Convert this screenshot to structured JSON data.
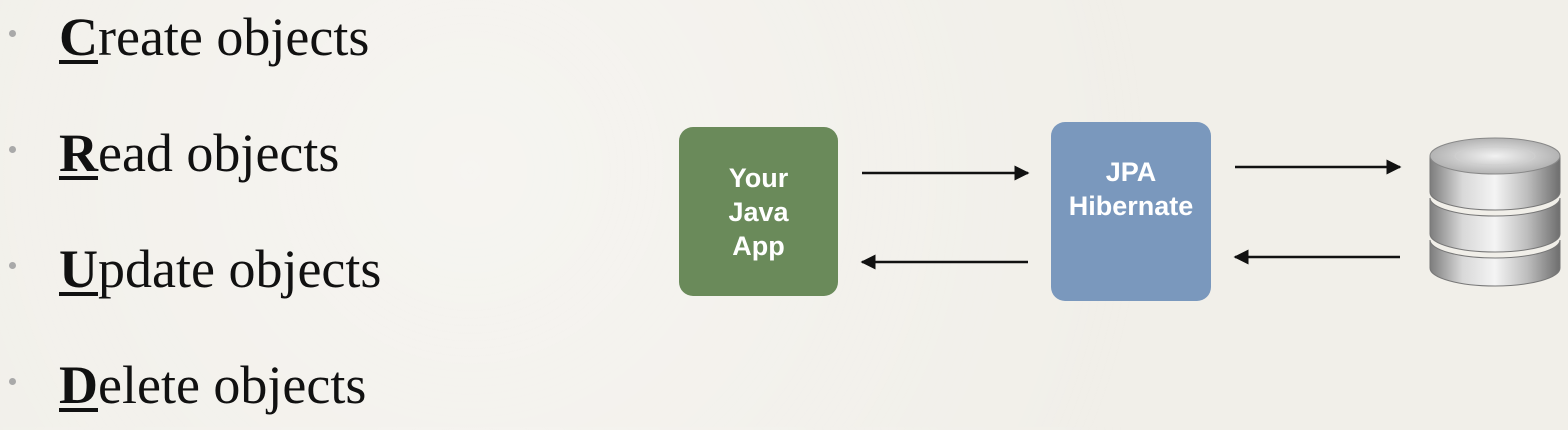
{
  "crud": {
    "items": [
      {
        "letter": "C",
        "rest": "reate objects"
      },
      {
        "letter": "R",
        "rest": "ead objects"
      },
      {
        "letter": "U",
        "rest": "pdate objects"
      },
      {
        "letter": "D",
        "rest": "elete objects"
      }
    ]
  },
  "diagram": {
    "app_box": {
      "label": "Your\nJava\nApp",
      "color": "#6a8a5a"
    },
    "jpa_box": {
      "label": "JPA\nHibernate",
      "color": "#7a98bd"
    },
    "database_icon": "database-icon"
  }
}
